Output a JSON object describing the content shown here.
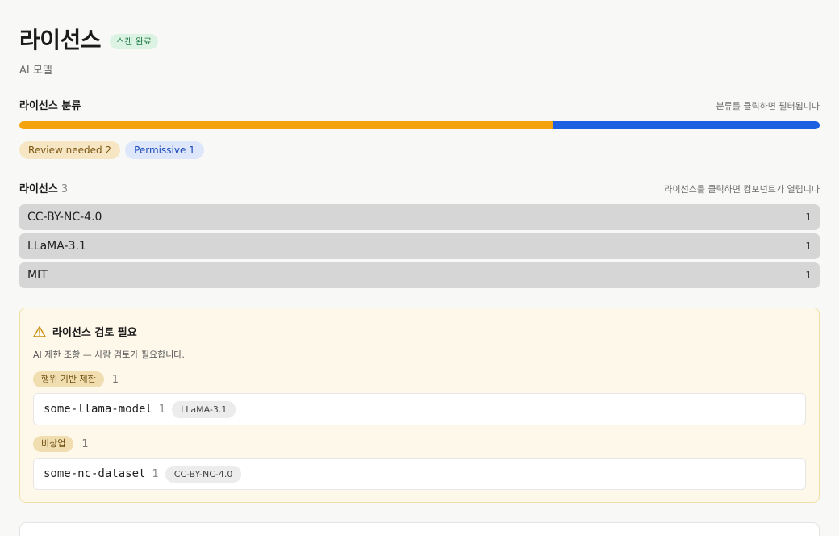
{
  "header": {
    "title": "라이선스",
    "scan_badge": "스캔 완료",
    "subtitle": "AI 모델"
  },
  "distribution": {
    "title": "라이선스 분류",
    "hint": "분류를 클릭하면 필터됩니다",
    "segments": [
      {
        "label": "Review needed",
        "count": 2,
        "color": "#f4a30d"
      },
      {
        "label": "Permissive",
        "count": 1,
        "color": "#1c5fe0"
      }
    ],
    "chips": [
      {
        "text": "Review needed 2",
        "bg": "#f6e6c4",
        "fg": "#7a5410"
      },
      {
        "text": "Permissive 1",
        "bg": "#dde6fa",
        "fg": "#1b4bb8"
      }
    ]
  },
  "licenses": {
    "title": "라이선스",
    "count": "3",
    "hint": "라이선스를 클릭하면 컴포넌트가 열립니다",
    "items": [
      {
        "name": "CC-BY-NC-4.0",
        "count": "1"
      },
      {
        "name": "LLaMA-3.1",
        "count": "1"
      },
      {
        "name": "MIT",
        "count": "1"
      }
    ]
  },
  "review": {
    "title": "라이선스 검토 필요",
    "description": "AI 제한 조항 — 사람 검토가 필요합니다.",
    "icon": "warning-triangle-icon",
    "groups": [
      {
        "tag": "행위 기반 제한",
        "count": "1",
        "component": {
          "name": "some-llama-model",
          "count": "1",
          "license": "LLaMA-3.1"
        }
      },
      {
        "tag": "비상업",
        "count": "1",
        "component": {
          "name": "some-nc-dataset",
          "count": "1",
          "license": "CC-BY-NC-4.0"
        }
      }
    ]
  }
}
